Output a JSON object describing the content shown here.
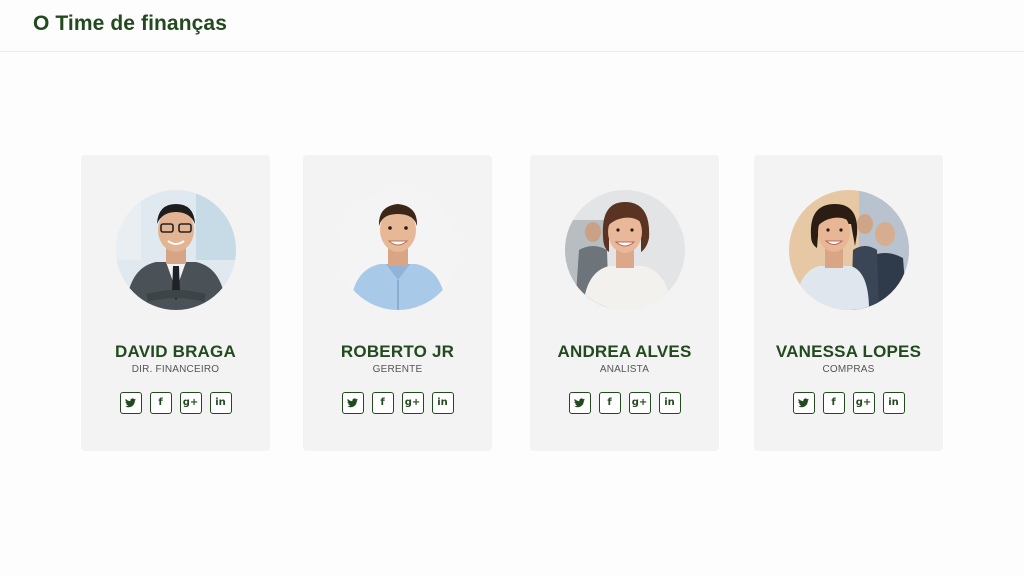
{
  "header": {
    "title": "O Time de finanças"
  },
  "colors": {
    "accent": "#234a1f",
    "card_bg": "#f3f3f3"
  },
  "team": [
    {
      "name": "DAVID BRAGA",
      "role": "DIR. FINANCEIRO",
      "photo": "man-in-suit-photo"
    },
    {
      "name": "ROBERTO JR",
      "role": "GERENTE",
      "photo": "man-blue-shirt-photo"
    },
    {
      "name": "ANDREA ALVES",
      "role": "ANALISTA",
      "photo": "woman-white-blouse-photo"
    },
    {
      "name": "VANESSA LOPES",
      "role": "COMPRAS",
      "photo": "woman-office-photo"
    }
  ],
  "social_icons": [
    "twitter-icon",
    "facebook-icon",
    "google-plus-icon",
    "linkedin-icon"
  ],
  "social_glyphs": {
    "facebook": "f",
    "google_plus": "g+",
    "linkedin": "in"
  }
}
